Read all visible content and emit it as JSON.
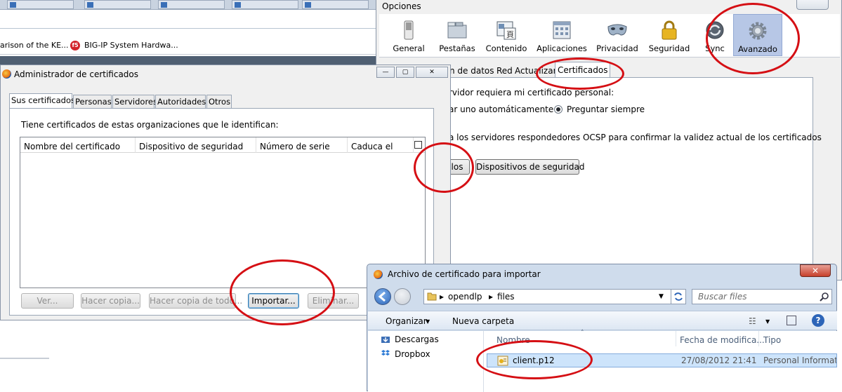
{
  "background_browser": {
    "bookmarks": [
      "arison of the KE...",
      "BIG-IP System Hardwa..."
    ]
  },
  "options_window": {
    "title": "Opciones",
    "panes": [
      {
        "label": "General",
        "icon": "switch-icon"
      },
      {
        "label": "Pestañas",
        "icon": "tabs-icon"
      },
      {
        "label": "Contenido",
        "icon": "content-icon"
      },
      {
        "label": "Aplicaciones",
        "icon": "applications-icon"
      },
      {
        "label": "Privacidad",
        "icon": "mask-icon"
      },
      {
        "label": "Seguridad",
        "icon": "padlock-icon"
      },
      {
        "label": "Sync",
        "icon": "sync-icon"
      },
      {
        "label": "Avanzado",
        "icon": "gear-icon",
        "selected": true
      }
    ],
    "tabs": [
      "n de datos",
      "Red",
      "Actualizar",
      "Certificados"
    ],
    "selected_tab": "Certificados",
    "line1": "rvidor requiera mi certificado personal:",
    "radio_auto": "ar uno automáticamente",
    "radio_ask": "Preguntar siempre",
    "line_ocsp": "a los servidores respondedores OCSP para confirmar la validez actual de los certificados",
    "btn_partial": "los",
    "btn_devices": "Dispositivos de seguridad"
  },
  "cert_manager": {
    "title": "Administrador de certificados",
    "tabs": [
      "Sus certificados",
      "Personas",
      "Servidores",
      "Autoridades",
      "Otros"
    ],
    "selected_tab": "Sus certificados",
    "description": "Tiene certificados de estas organizaciones que le identifican:",
    "columns": [
      "Nombre del certificado",
      "Dispositivo de seguridad",
      "Número de serie",
      "Caduca el"
    ],
    "buttons": {
      "view": "Ver...",
      "backup": "Hacer copia...",
      "backup_all": "Hacer copia de todo...",
      "import": "Importar...",
      "delete": "Eliminar..."
    }
  },
  "file_dialog": {
    "title": "Archivo de certificado para importar",
    "breadcrumb": [
      "opendlp",
      "files"
    ],
    "search_placeholder": "Buscar files",
    "organize": "Organizar",
    "new_folder": "Nueva carpeta",
    "nav_items": [
      "Descargas",
      "Dropbox"
    ],
    "columns": [
      "Nombre",
      "Fecha de modifica...",
      "Tipo"
    ],
    "files": [
      {
        "name": "client.p12",
        "modified": "27/08/2012 21:41",
        "type": "Personal Informati"
      }
    ]
  },
  "accent_colors": {
    "annotation": "#d50f14",
    "selected_pane": "#b7c7e6",
    "selected_row": "#cde4fb"
  }
}
